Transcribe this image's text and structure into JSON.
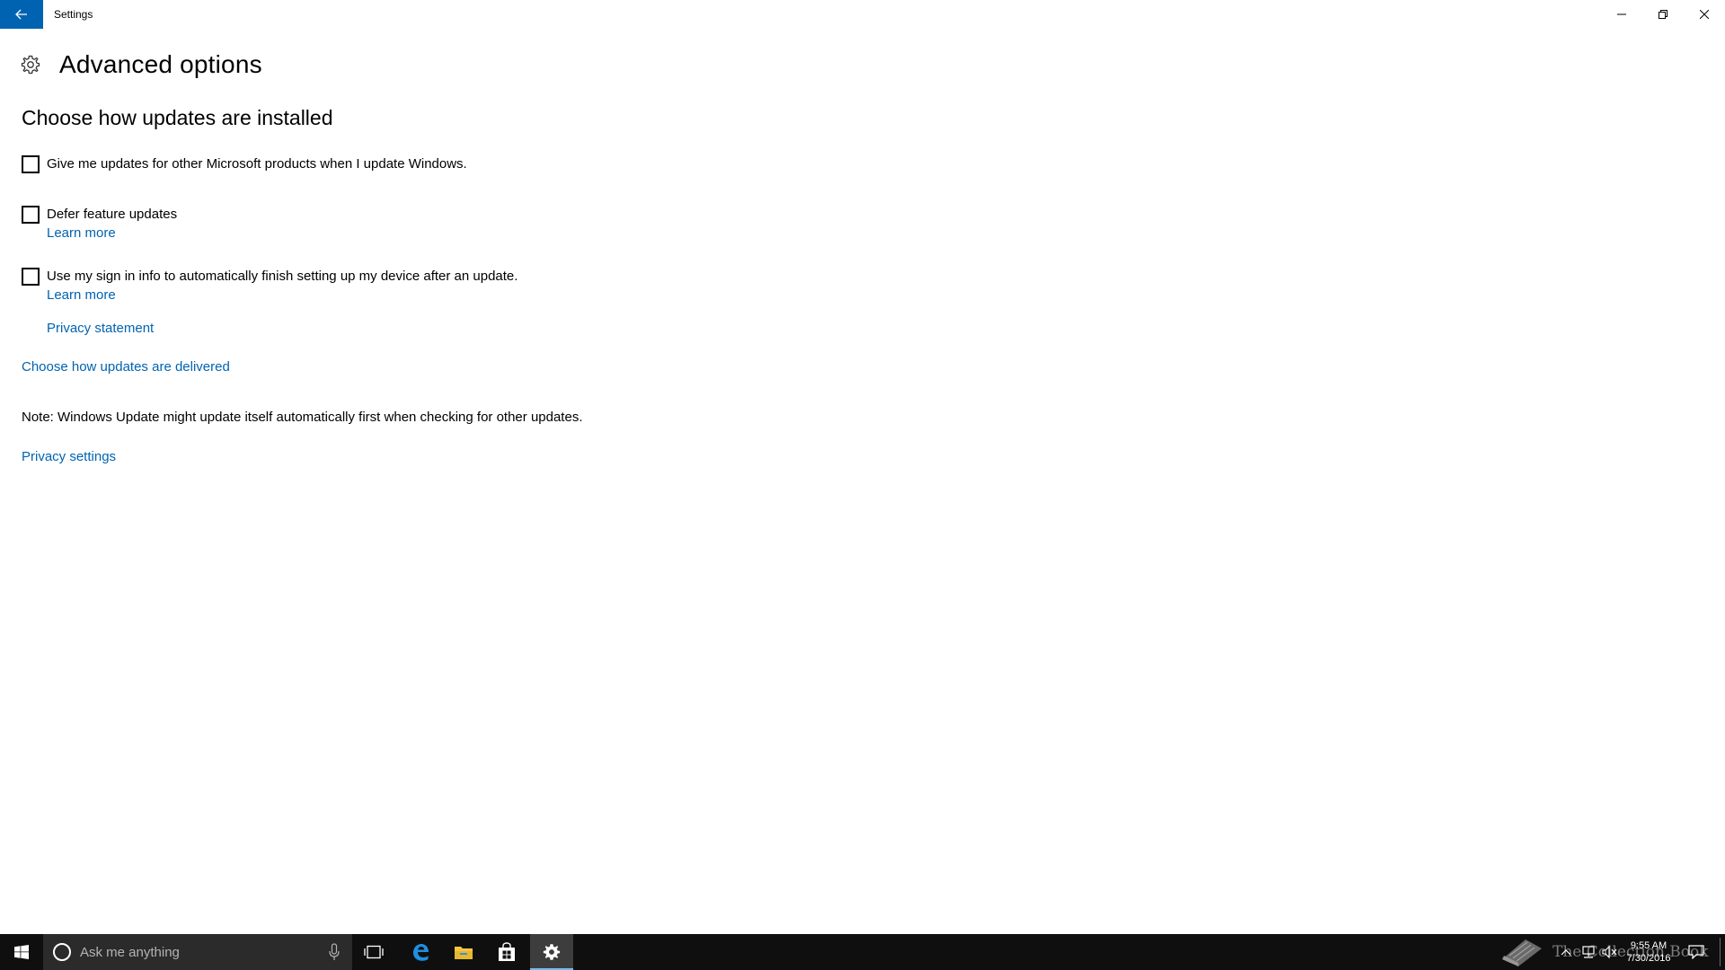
{
  "window": {
    "title": "Settings",
    "controls": {
      "minimize": "minimize-icon",
      "maximize": "restore-icon",
      "close": "close-icon"
    }
  },
  "header": {
    "icon": "gear-icon",
    "title": "Advanced options"
  },
  "section": {
    "title": "Choose how updates are installed"
  },
  "options": [
    {
      "label": "Give me updates for other Microsoft products when I update Windows.",
      "checked": false
    },
    {
      "label": "Defer feature updates",
      "checked": false,
      "link": "Learn more"
    },
    {
      "label": "Use my sign in info to automatically finish setting up my device after an update.",
      "checked": false,
      "link": "Learn more"
    }
  ],
  "links": {
    "privacy_statement": "Privacy statement",
    "delivery": "Choose how updates are delivered",
    "privacy_settings": "Privacy settings"
  },
  "note": "Note: Windows Update might update itself automatically first when checking for other updates.",
  "taskbar": {
    "search_placeholder": "Ask me anything",
    "pinned": [
      "task-view-icon",
      "edge-icon",
      "file-explorer-icon",
      "store-icon",
      "settings-icon"
    ],
    "watermark": "The Collection Book",
    "clock": {
      "time": "9:55 AM",
      "date": "7/30/2016"
    }
  },
  "colors": {
    "accent": "#0063b1",
    "link": "#0063b1",
    "taskbar": "#0f0f0f",
    "search_box": "#2b2b2b"
  }
}
